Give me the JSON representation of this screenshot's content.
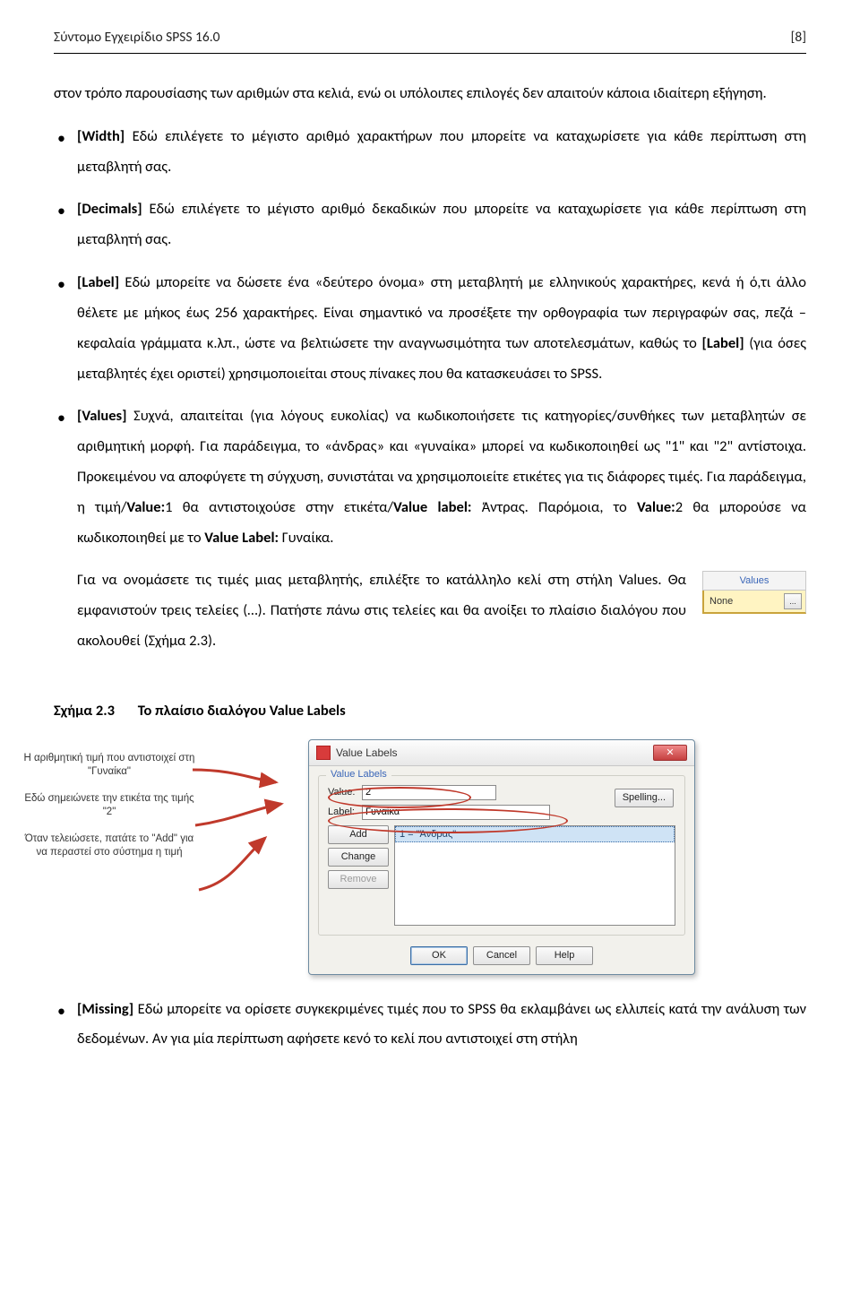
{
  "header": {
    "left": "Σύντομο Εγχειρίδιο SPSS 16.0",
    "right": "[8]"
  },
  "intro": "στον τρόπο παρουσίασης των αριθμών στα κελιά, ενώ οι υπόλοιπες επιλογές δεν απαιτούν κάποια ιδιαίτερη εξήγηση.",
  "bullets": {
    "b1_label": "[Width] ",
    "b1_text": "Εδώ επιλέγετε το μέγιστο αριθμό χαρακτήρων που μπορείτε να καταχωρίσετε για κάθε περίπτωση στη μεταβλητή σας.",
    "b2_label": "[Decimals] ",
    "b2_text": "Εδώ επιλέγετε το μέγιστο αριθμό δεκαδικών που μπορείτε να καταχωρίσετε για κάθε περίπτωση στη μεταβλητή σας.",
    "b3_label": "[Label] ",
    "b3_text_a": "Εδώ μπορείτε να δώσετε ένα «δεύτερο όνομα» στη μεταβλητή με ελληνικούς χαρακτήρες, κενά ή ό,τι άλλο θέλετε με μήκος έως 256 χαρακτήρες. Είναι σημαντικό να προσέξετε την ορθογραφία των περιγραφών σας, πεζά – κεφαλαία γράμματα κ.λπ., ώστε να βελτιώσετε την αναγνωσιμότητα των αποτελεσμάτων, καθώς το ",
    "b3_text_b": "[Label]",
    "b3_text_c": " (για όσες μεταβλητές έχει οριστεί) χρησιμοποιείται στους πίνακες που θα κατασκευάσει το SPSS.",
    "b4_label": "[Values] ",
    "b4_text_a": "Συχνά, απαιτείται (για λόγους ευκολίας) να κωδικοποιήσετε τις κατηγορίες/συνθήκες των μεταβλητών σε αριθμητική μορφή. Για παράδειγμα, το «άνδρας» και «γυναίκα» μπορεί να κωδικοποιηθεί ως \"1\" και \"2\" αντίστοιχα. Προκειμένου να αποφύγετε τη σύγχυση, συνιστάται να χρησιμοποιείτε ετικέτες για τις διάφορες τιμές. Για παράδειγμα, η τιμή/",
    "b4_text_b": "Value:",
    "b4_text_c": "1 θα αντιστοιχούσε στην ετικέτα/",
    "b4_text_d": "Value label:",
    "b4_text_e": " Άντρας. Παρόμοια, το ",
    "b4_text_f": "Value:",
    "b4_text_g": "2 θα μπορούσε να κωδικοποιηθεί με το ",
    "b4_text_h": "Value Label:",
    "b4_text_i": " Γυναίκα."
  },
  "values_para": "Για να ονομάσετε τις τιμές μιας μεταβλητής, επιλέξτε το κατάλληλο κελί στη στήλη Values. Θα εμφανιστούν τρεις τελείες (…). Πατήστε πάνω στις τελείες και θα ανοίξει το πλαίσιο διαλόγου που ακολουθεί (Σχήμα 2.3).",
  "values_snippet": {
    "header": "Values",
    "cell_text": "None",
    "cell_btn": "..."
  },
  "figure": {
    "heading_label": "Σχήμα 2.3",
    "heading_text": "Το πλαίσιο διαλόγου Value Labels"
  },
  "annotations": {
    "a1": "Η αριθμητική τιμή που αντιστοιχεί στη \"Γυναίκα\"",
    "a2": "Εδώ σημειώνετε την ετικέτα της τιμής \"2\"",
    "a3": "Όταν τελειώσετε, πατάτε το \"Add\" για να περαστεί στο σύστημα η τιμή"
  },
  "dialog": {
    "title": "Value Labels",
    "group_legend": "Value Labels",
    "value_label": "Value:",
    "value_input": "2",
    "label_label": "Label:",
    "label_input": "Γυναίκα",
    "spell": "Spelling...",
    "add": "Add",
    "change": "Change",
    "remove": "Remove",
    "list_item": "1 = \"Άνδρας\"",
    "ok": "OK",
    "cancel": "Cancel",
    "help": "Help"
  },
  "missing": {
    "label": "[Missing] ",
    "text": "Εδώ μπορείτε να ορίσετε συγκεκριμένες τιμές που το SPSS θα εκλαμβάνει ως ελλιπείς κατά την ανάλυση των δεδομένων. Αν για μία περίπτωση αφήσετε κενό το κελί που αντιστοιχεί στη στήλη"
  }
}
